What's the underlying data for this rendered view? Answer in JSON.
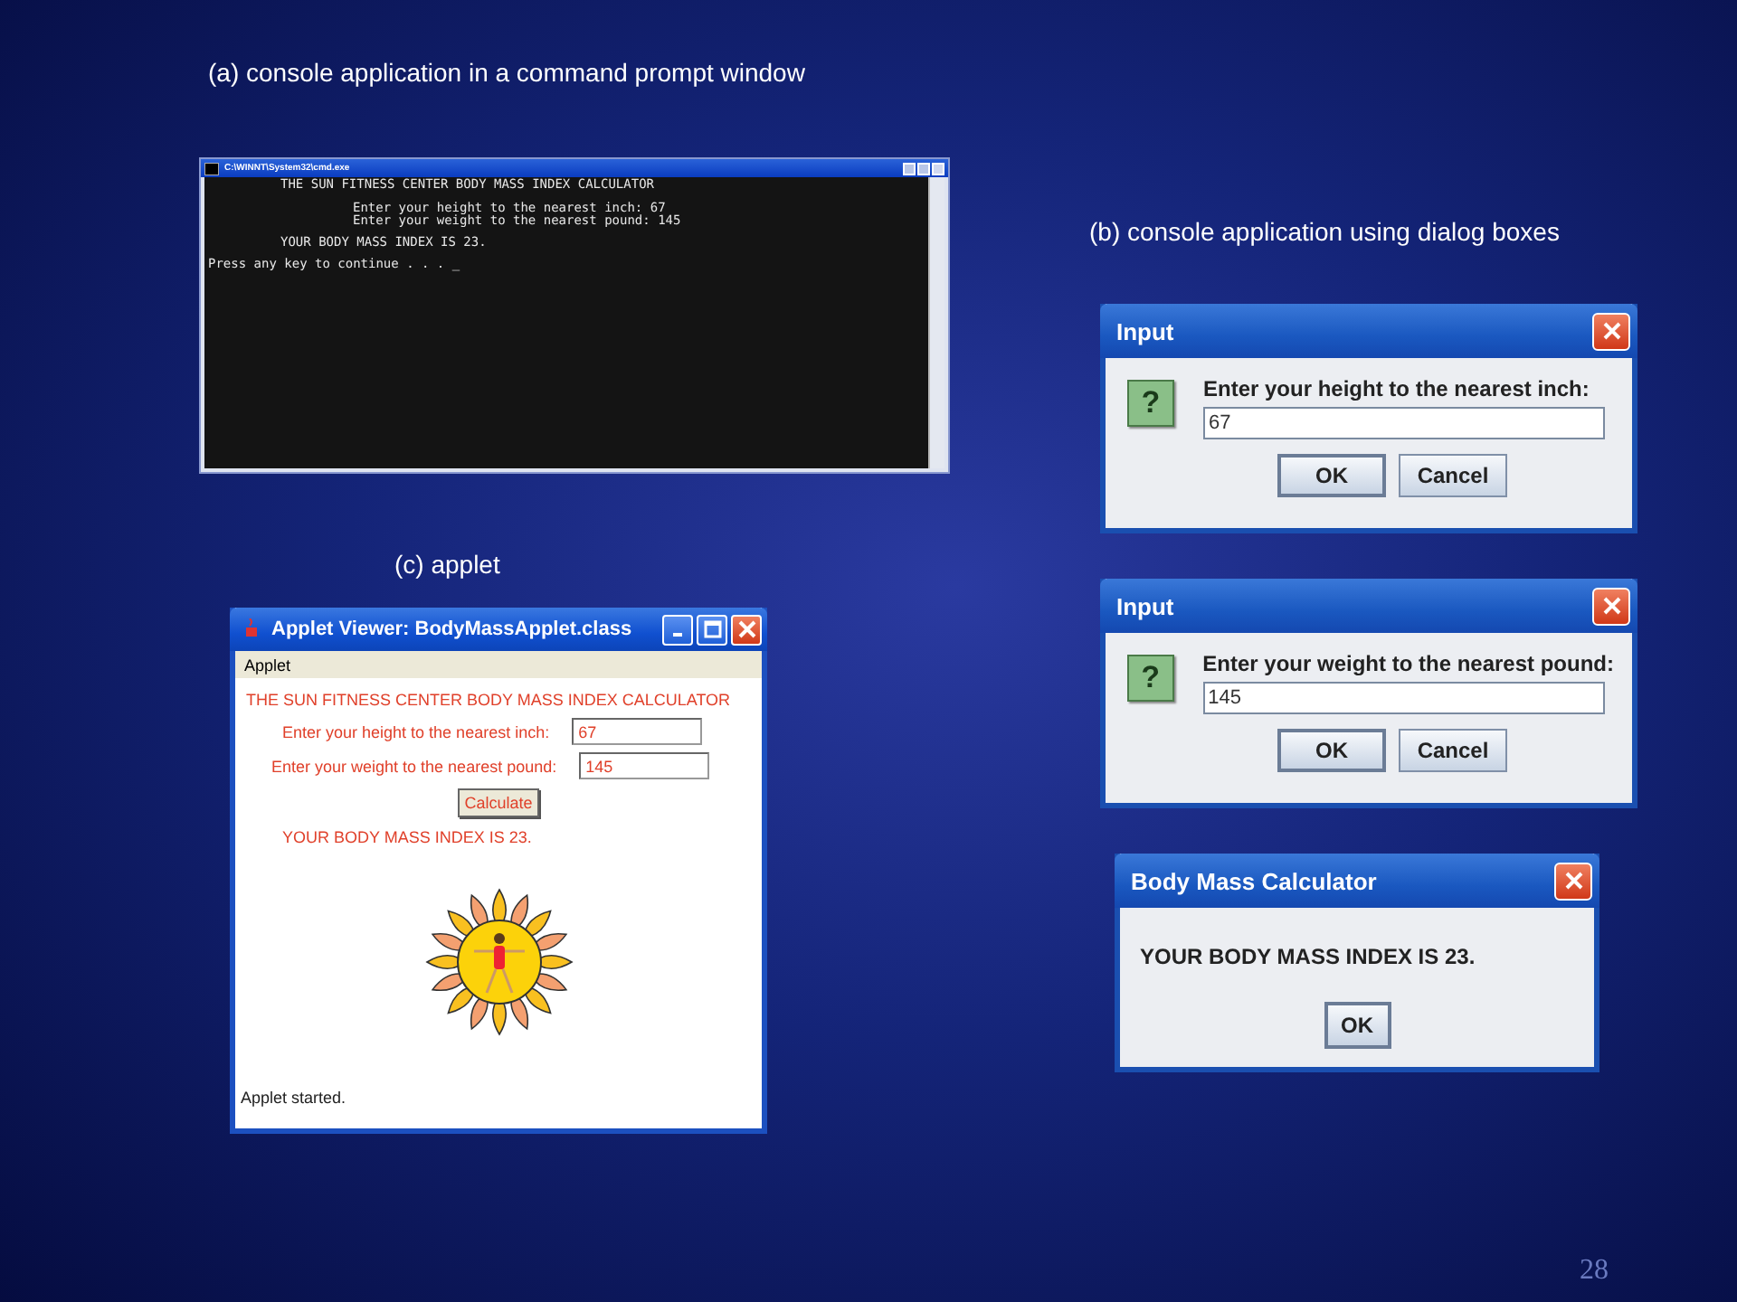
{
  "console_section": {
    "caption": "(a) console application in a command prompt window",
    "window": {
      "title": "C:\\WINNT\\System32\\cmd.exe",
      "lines": [
        {
          "kind": "heading",
          "text": "THE SUN FITNESS CENTER BODY MASS INDEX CALCULATOR"
        },
        {
          "kind": "entry",
          "text": "Enter your height to the nearest inch: 67"
        },
        {
          "kind": "entry",
          "text": "Enter your weight to the nearest pound: 145"
        },
        {
          "kind": "result",
          "text": "YOUR BODY MASS INDEX IS 23."
        },
        {
          "kind": "prompt",
          "text": "Press any key to continue . . . _"
        }
      ]
    }
  },
  "dialog_section": {
    "caption": "(b) console application using dialog boxes",
    "dialogs": [
      {
        "kind": "input",
        "title": "Input",
        "icon": "?",
        "prompt": "Enter your height to the nearest inch:",
        "value": "67",
        "buttons": [
          "OK",
          "Cancel"
        ]
      },
      {
        "kind": "input",
        "title": "Input",
        "icon": "?",
        "prompt": "Enter your weight to the nearest pound:",
        "value": "145",
        "buttons": [
          "OK",
          "Cancel"
        ]
      },
      {
        "kind": "message",
        "title": "Body Mass Calculator",
        "message": "YOUR BODY MASS INDEX IS 23.",
        "buttons": [
          "OK"
        ]
      }
    ]
  },
  "applet_section": {
    "caption": "(c) applet",
    "window": {
      "title": "Applet Viewer: BodyMassApplet.class",
      "menu": [
        "Applet"
      ],
      "heading": "THE SUN FITNESS CENTER BODY MASS INDEX CALCULATOR",
      "fields": [
        {
          "label": "Enter your height to the nearest inch:",
          "value": "67"
        },
        {
          "label": "Enter your weight to the nearest pound:",
          "value": "145"
        }
      ],
      "button": "Calculate",
      "result": "YOUR BODY MASS INDEX IS 23.",
      "status": "Applet started."
    }
  },
  "page_number": "28"
}
